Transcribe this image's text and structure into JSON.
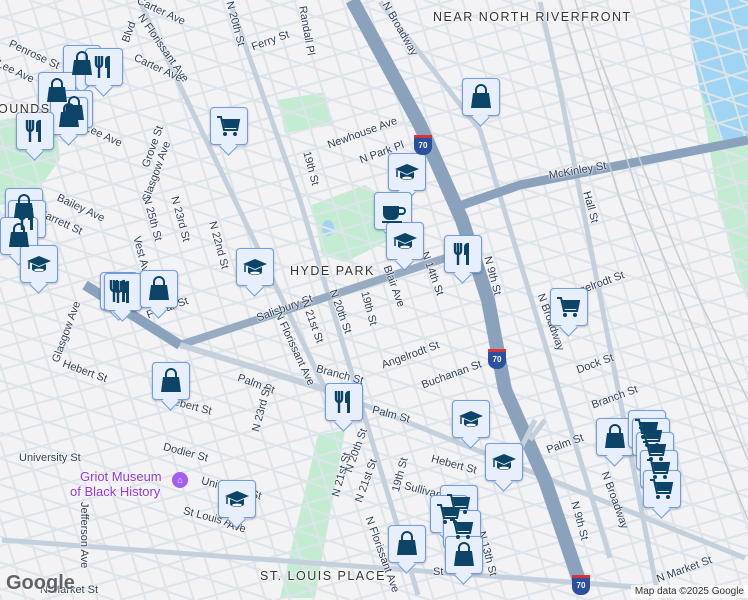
{
  "map": {
    "areas": [
      "NEAR NORTH RIVERFRONT",
      "HYDE PARK",
      "ST. LOUIS PLACE",
      "OUNDS"
    ],
    "poi": {
      "name_line1": "Griot Museum",
      "name_line2": "of Black History",
      "icon": "museum-icon"
    },
    "streets": [
      "Carter Ave",
      "Penrose St",
      "Lee Ave",
      "Blvd",
      "N Florissant Ave",
      "Carter Ave",
      "Ferry St",
      "N 20th St",
      "Randall Pl",
      "N Broadway",
      "Lee Ave",
      "Grove St",
      "Glasgow Ave",
      "Newhouse Ave",
      "19th St",
      "N Park Pl",
      "Bailey Ave",
      "Barrett St",
      "N 25th St",
      "N 23rd St",
      "N 22nd St",
      "Vest Ave",
      "Salisbury St",
      "N 21st St",
      "N 20th St",
      "19th St",
      "Blair Ave",
      "N 14th St",
      "McKinley St",
      "Hall St",
      "N 9th St",
      "Angelrodt St",
      "N Broadway",
      "Dock St",
      "Farrar St",
      "Glasgow Ave",
      "Hebert St",
      "Palm St",
      "Hebert St",
      "Branch St",
      "N Florissant Ave",
      "N 23rd St",
      "Angelrodt St",
      "Buchanan St",
      "Palm St",
      "Branch St",
      "Palm St",
      "Hebert St",
      "Dodier St",
      "University St",
      "University St",
      "St Louis Ave",
      "Jefferson Ave",
      "N 21st St",
      "N 20th St",
      "Sullivan Ave",
      "19th St",
      "N 13th St",
      "N 9th St",
      "N Broadway",
      "N Market St",
      "N Market St",
      "N Florissant Ave",
      "N 21st St",
      "Ave",
      "St"
    ],
    "highway_shield": "70",
    "google_logo": "Google",
    "attribution": "Map data ©2025 Google",
    "colors": {
      "land": "#f3f2f4",
      "road": "#d4dde6",
      "highway": "#8aa2bb",
      "arterial": "#c4d0dc",
      "park": "#c3ecd2",
      "water": "#9fd5f3",
      "marker_bg": "#e8effc",
      "marker_border": "#6f9be0",
      "icon": "#0b4467"
    }
  },
  "markers": [
    "shopping-bag",
    "restaurant",
    "shopping-bag",
    "shopping-bag",
    "shopping-bag",
    "restaurant",
    "shopping-cart",
    "school",
    "coffee",
    "school",
    "restaurant",
    "shopping-bag",
    "shopping-cart",
    "shopping-bag",
    "restaurant",
    "shopping-bag",
    "school",
    "restaurant",
    "restaurant",
    "shopping-bag",
    "school",
    "shopping-bag",
    "restaurant",
    "school",
    "school",
    "shopping-bag",
    "shopping-cart",
    "shopping-cart",
    "shopping-cart",
    "shopping-cart",
    "shopping-cart",
    "school",
    "shopping-cart",
    "shopping-cart",
    "shopping-cart",
    "shopping-bag",
    "shopping-bag"
  ]
}
